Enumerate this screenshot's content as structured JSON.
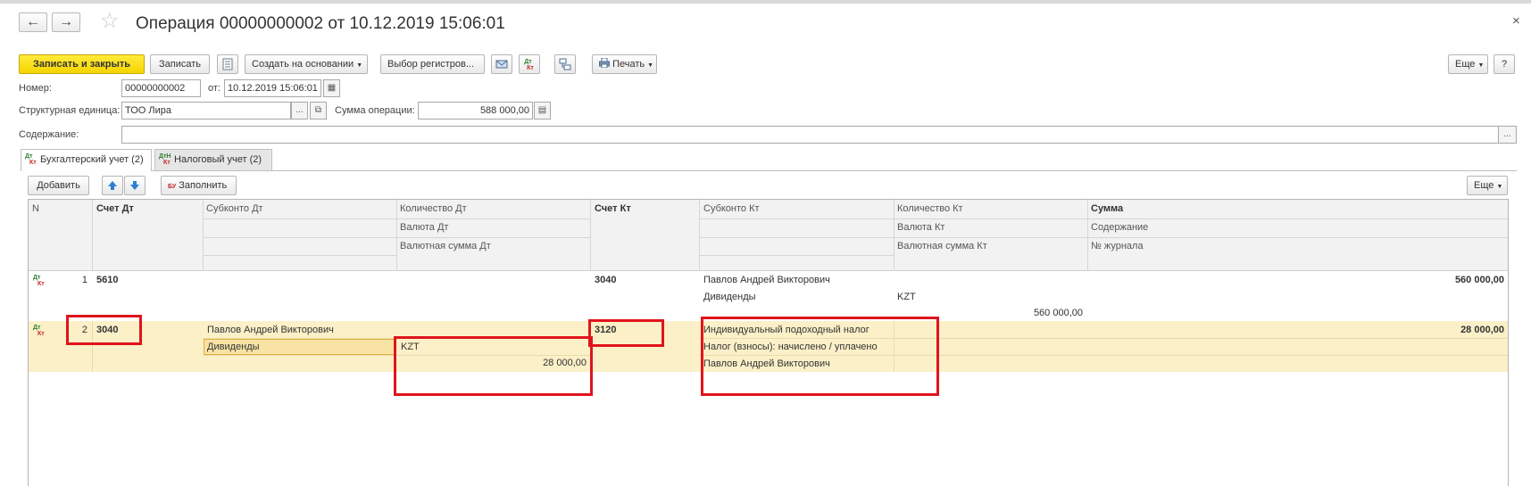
{
  "window": {
    "title": "Операция 00000000002 от 10.12.2019 15:06:01",
    "close": "×",
    "back": "←",
    "forward": "→",
    "star": "☆"
  },
  "toolbar": {
    "save_close": "Записать и закрыть",
    "save": "Записать",
    "create_based": "Создать на основании",
    "register_select": "Выбор регистров...",
    "print": "Печать",
    "more": "Еще",
    "help": "?"
  },
  "form": {
    "number_label": "Номер:",
    "number_value": "00000000002",
    "date_label": "от:",
    "date_value": "10.12.2019 15:06:01",
    "unit_label": "Структурная единица:",
    "unit_value": "ТОО  Лира",
    "sum_label": "Сумма операции:",
    "sum_value": "588 000,00",
    "content_label": "Содержание:",
    "content_value": "",
    "ellipsis": "..."
  },
  "tabs": [
    {
      "label": "Бухгалтерский учет (2)",
      "active": true
    },
    {
      "label": "Налоговый учет (2)",
      "active": false
    }
  ],
  "table_toolbar": {
    "add": "Добавить",
    "fill": "Заполнить",
    "more": "Еще"
  },
  "table": {
    "headers": {
      "n": "N",
      "acc_dt": "Счет Дт",
      "subkonto_dt": "Субконто Дт",
      "qty_dt": "Количество Дт",
      "currency_dt": "Валюта Дт",
      "cur_sum_dt": "Валютная сумма Дт",
      "acc_kt": "Счет Кт",
      "subkonto_kt": "Субконто Кт",
      "qty_kt": "Количество Кт",
      "currency_kt": "Валюта Кт",
      "cur_sum_kt": "Валютная сумма Кт",
      "sum": "Сумма",
      "content": "Содержание",
      "journal": "№ журнала"
    },
    "rows": [
      {
        "n": "1",
        "acc_dt": "5610",
        "subkonto_dt": [
          "",
          "",
          ""
        ],
        "currency_dt": "",
        "cur_sum_dt": "",
        "acc_kt": "3040",
        "subkonto_kt": [
          "Павлов Андрей Викторович",
          "Дивиденды",
          ""
        ],
        "currency_kt": "KZT",
        "cur_sum_kt": "560 000,00",
        "sum": "560 000,00"
      },
      {
        "n": "2",
        "acc_dt": "3040",
        "subkonto_dt": [
          "Павлов Андрей Викторович",
          "Дивиденды",
          ""
        ],
        "currency_dt": "KZT",
        "cur_sum_dt": "28 000,00",
        "acc_kt": "3120",
        "subkonto_kt": [
          "Индивидуальный подоходный налог",
          "Налог (взносы): начислено / уплачено",
          "Павлов Андрей Викторович"
        ],
        "currency_kt": "",
        "cur_sum_kt": "",
        "sum": "28 000,00"
      }
    ]
  },
  "icons": {
    "dt": "Дт",
    "kt": "Кт",
    "dtn": "ДтН"
  },
  "colors": {
    "primary_button": "#f5d400",
    "selected_row": "#fbf0c8",
    "highlight_box": "#e0141c"
  }
}
